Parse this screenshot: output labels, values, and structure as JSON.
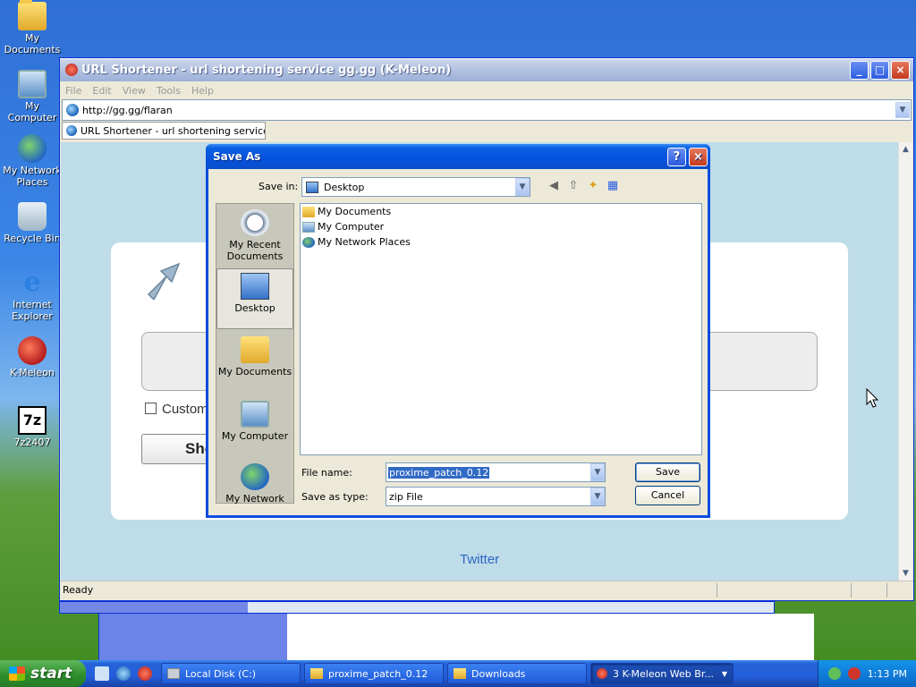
{
  "desktop": {
    "icons": [
      {
        "label": "My Documents"
      },
      {
        "label": "My Computer"
      },
      {
        "label": "My Network Places"
      },
      {
        "label": "Recycle Bin"
      },
      {
        "label": "Internet Explorer"
      },
      {
        "label": "K-Meleon"
      },
      {
        "label": "7z2407"
      }
    ]
  },
  "browser": {
    "title": "URL Shortener - url shortening service gg.gg (K-Meleon)",
    "menu": [
      "File",
      "Edit",
      "View",
      "Tools",
      "Help"
    ],
    "address": "http://gg.gg/flaran",
    "tab_label": "URL Shortener - url shortening service ...",
    "page": {
      "custom_label": "Custom",
      "shorten_button": "Sho",
      "twitter_link": "Twitter"
    },
    "status_text": "Ready"
  },
  "dialog": {
    "title": "Save As",
    "help_glyph": "?",
    "close_glyph": "×",
    "save_in_label": "Save in:",
    "save_in_value": "Desktop",
    "places": [
      {
        "label": "My Recent Documents"
      },
      {
        "label": "Desktop"
      },
      {
        "label": "My Documents"
      },
      {
        "label": "My Computer"
      },
      {
        "label": "My Network"
      }
    ],
    "files": [
      {
        "name": "My Documents",
        "icon": "folder-icon"
      },
      {
        "name": "My Computer",
        "icon": "computer-icon"
      },
      {
        "name": "My Network Places",
        "icon": "network-icon"
      }
    ],
    "file_name_label": "File name:",
    "file_name_value": "proxime_patch_0.12",
    "save_type_label": "Save as type:",
    "save_type_value": "zip File",
    "save_button": "Save",
    "cancel_button": "Cancel"
  },
  "taskbar": {
    "start_label": "start",
    "tasks": [
      {
        "label": "Local Disk (C:)"
      },
      {
        "label": "proxime_patch_0.12"
      },
      {
        "label": "Downloads"
      },
      {
        "label": "3 K-Meleon Web Br..."
      }
    ],
    "clock": "1:13 PM"
  }
}
